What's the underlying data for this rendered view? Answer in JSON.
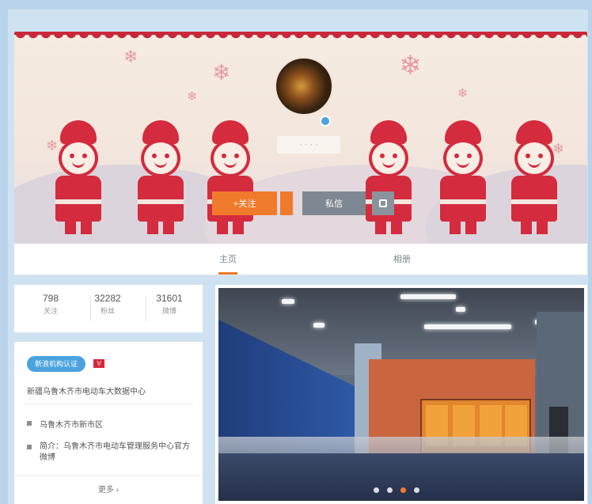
{
  "profile": {
    "nickname": "· · · ·",
    "follow_label": "+关注",
    "message_label": "私信"
  },
  "tabs": [
    {
      "label": "主页",
      "active": true
    },
    {
      "label": "相册",
      "active": false
    }
  ],
  "stats": [
    {
      "value": "798",
      "label": "关注"
    },
    {
      "value": "32282",
      "label": "粉丝"
    },
    {
      "value": "31601",
      "label": "微博"
    }
  ],
  "info": {
    "verified_badge": "新浪机构认证",
    "red_badge": "V",
    "intro": "新疆乌鲁木齐市电动车大数据中心",
    "items": [
      "乌鲁木齐市新市区",
      "简介：乌鲁木齐市电动车管理服务中心官方微博"
    ],
    "more_label": "更多 ›"
  },
  "carousel": {
    "slide_count": 4,
    "active_index": 2
  },
  "colors": {
    "accent": "#f07a2c",
    "verified": "#4aa3df",
    "paper_red": "#d42b3e",
    "background": "#b9d4ea"
  }
}
